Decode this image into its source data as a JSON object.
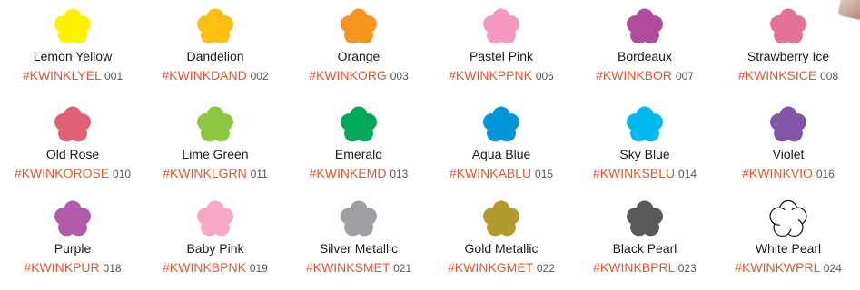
{
  "swatches": [
    {
      "name": "Lemon Yellow",
      "code": "#KWINKLYEL",
      "num": "001",
      "color": "#fff200",
      "outline": false
    },
    {
      "name": "Dandelion",
      "code": "#KWINKDAND",
      "num": "002",
      "color": "#fdc010",
      "outline": false
    },
    {
      "name": "Orange",
      "code": "#KWINKORG",
      "num": "003",
      "color": "#f7941d",
      "outline": false
    },
    {
      "name": "Pastel Pink",
      "code": "#KWINKPPNK",
      "num": "006",
      "color": "#f49ac1",
      "outline": false
    },
    {
      "name": "Bordeaux",
      "code": "#KWINKBOR",
      "num": "007",
      "color": "#b14b9b",
      "outline": false
    },
    {
      "name": "Strawberry Ice",
      "code": "#KWINKSICE",
      "num": "008",
      "color": "#e46f97",
      "outline": false
    },
    {
      "name": "Old Rose",
      "code": "#KWINKOROSE",
      "num": "010",
      "color": "#e06075",
      "outline": false
    },
    {
      "name": "Lime Green",
      "code": "#KWINKLGRN",
      "num": "011",
      "color": "#8dc63f",
      "outline": false
    },
    {
      "name": "Emerald",
      "code": "#KWINKEMD",
      "num": "013",
      "color": "#00a85a",
      "outline": false
    },
    {
      "name": "Aqua Blue",
      "code": "#KWINKABLU",
      "num": "015",
      "color": "#0095d9",
      "outline": false
    },
    {
      "name": "Sky Blue",
      "code": "#KWINKSBLU",
      "num": "014",
      "color": "#00b8f0",
      "outline": false
    },
    {
      "name": "Violet",
      "code": "#KWINKVIO",
      "num": "016",
      "color": "#8057a6",
      "outline": false
    },
    {
      "name": "Purple",
      "code": "#KWINKPUR",
      "num": "018",
      "color": "#b15aa8",
      "outline": false
    },
    {
      "name": "Baby Pink",
      "code": "#KWINKBPNK",
      "num": "019",
      "color": "#f7a8c8",
      "outline": false
    },
    {
      "name": "Silver Metallic",
      "code": "#KWINKSMET",
      "num": "021",
      "color": "#9d9fa2",
      "outline": false
    },
    {
      "name": "Gold Metallic",
      "code": "#KWINKGMET",
      "num": "022",
      "color": "#b29a2e",
      "outline": false
    },
    {
      "name": "Black Pearl",
      "code": "#KWINKBPRL",
      "num": "023",
      "color": "#58595b",
      "outline": false
    },
    {
      "name": "White Pearl",
      "code": "#KWINKWPRL",
      "num": "024",
      "color": "#ffffff",
      "outline": true
    }
  ]
}
